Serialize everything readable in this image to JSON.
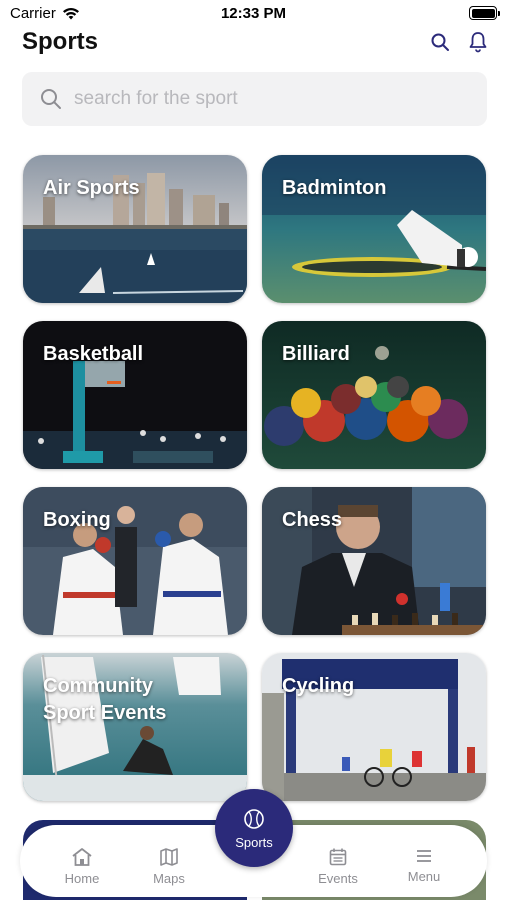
{
  "status_bar": {
    "carrier": "Carrier",
    "time": "12:33 PM"
  },
  "header": {
    "title": "Sports"
  },
  "search": {
    "placeholder": "search for the sport"
  },
  "sports": [
    {
      "label": "Air Sports"
    },
    {
      "label": "Badminton"
    },
    {
      "label": "Basketball"
    },
    {
      "label": "Billiard"
    },
    {
      "label": "Boxing"
    },
    {
      "label": "Chess"
    },
    {
      "label": "Community\nSport Events"
    },
    {
      "label": "Cycling"
    }
  ],
  "bottom_nav": {
    "home": "Home",
    "maps": "Maps",
    "center": "Sports",
    "events": "Events",
    "menu": "Menu"
  },
  "colors": {
    "accent": "#2b2a7a",
    "nav_inactive": "#8e8e93",
    "search_bg": "#f2f2f3"
  }
}
